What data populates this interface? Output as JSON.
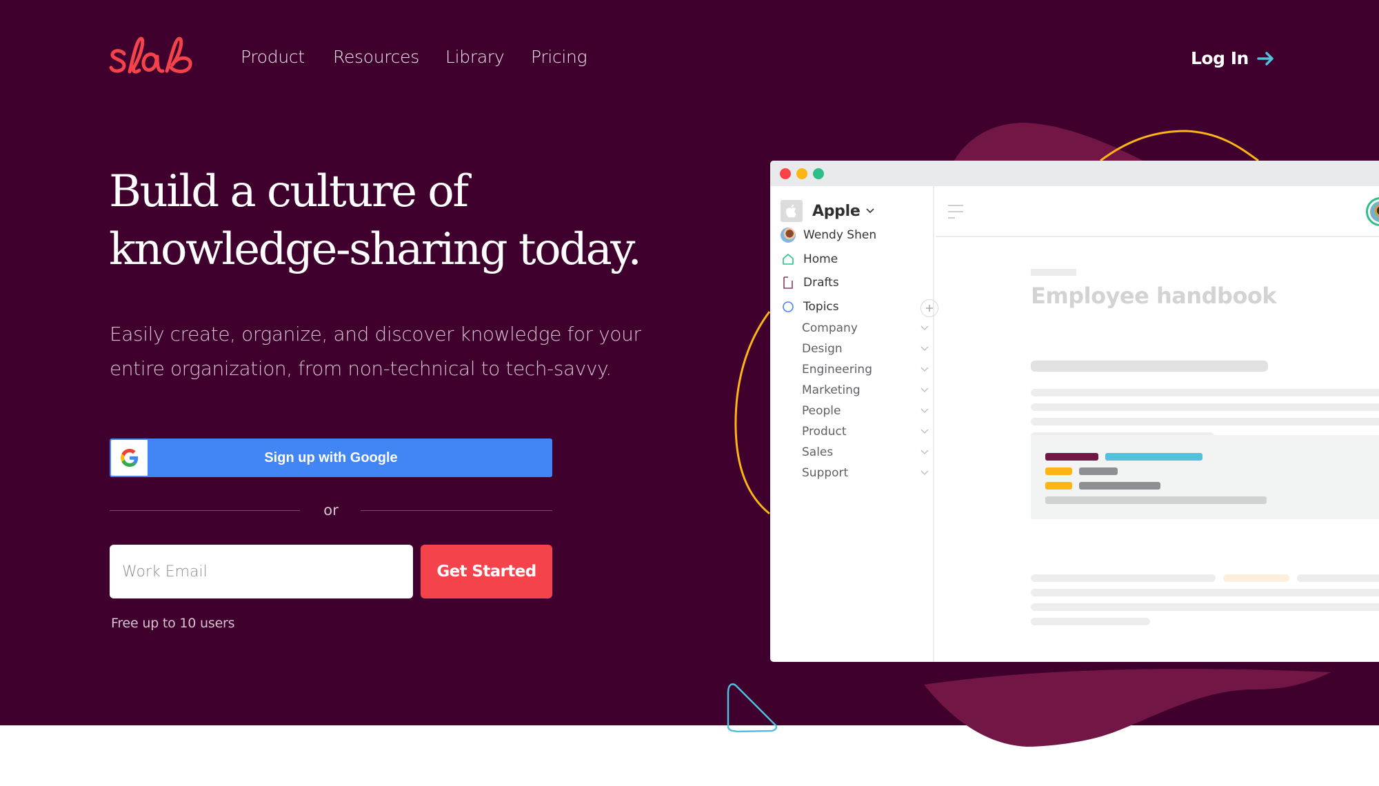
{
  "brand": {
    "logo_text": "slab",
    "accent": "#f4434a",
    "bg": "#3f002e"
  },
  "nav": {
    "links": [
      {
        "label": "Product"
      },
      {
        "label": "Resources"
      },
      {
        "label": "Library"
      },
      {
        "label": "Pricing"
      }
    ],
    "login_label": "Log In",
    "login_icon": "arrow-right-icon"
  },
  "hero": {
    "headline_line1": "Build a culture of",
    "headline_line2": "knowledge-sharing today.",
    "subtitle_line1": "Easily create, organize, and discover knowledge for your",
    "subtitle_line2": "entire organization, from non-technical to tech-savvy.",
    "google_button_label": "Sign up with Google",
    "divider_label": "or",
    "email_placeholder": "Work Email",
    "email_value": "",
    "cta_label": "Get Started",
    "footnote": "Free up to 10 users"
  },
  "app": {
    "org_name": "Apple",
    "sidebar": {
      "user_name": "Wendy Shen",
      "items": [
        {
          "label": "Home",
          "icon": "home-icon"
        },
        {
          "label": "Drafts",
          "icon": "drafts-icon"
        },
        {
          "label": "Topics",
          "icon": "topics-icon"
        }
      ],
      "topics": [
        {
          "label": "Company"
        },
        {
          "label": "Design"
        },
        {
          "label": "Engineering"
        },
        {
          "label": "Marketing"
        },
        {
          "label": "People"
        },
        {
          "label": "Product"
        },
        {
          "label": "Sales"
        },
        {
          "label": "Support"
        }
      ]
    },
    "document": {
      "title": "Employee handbook"
    }
  }
}
